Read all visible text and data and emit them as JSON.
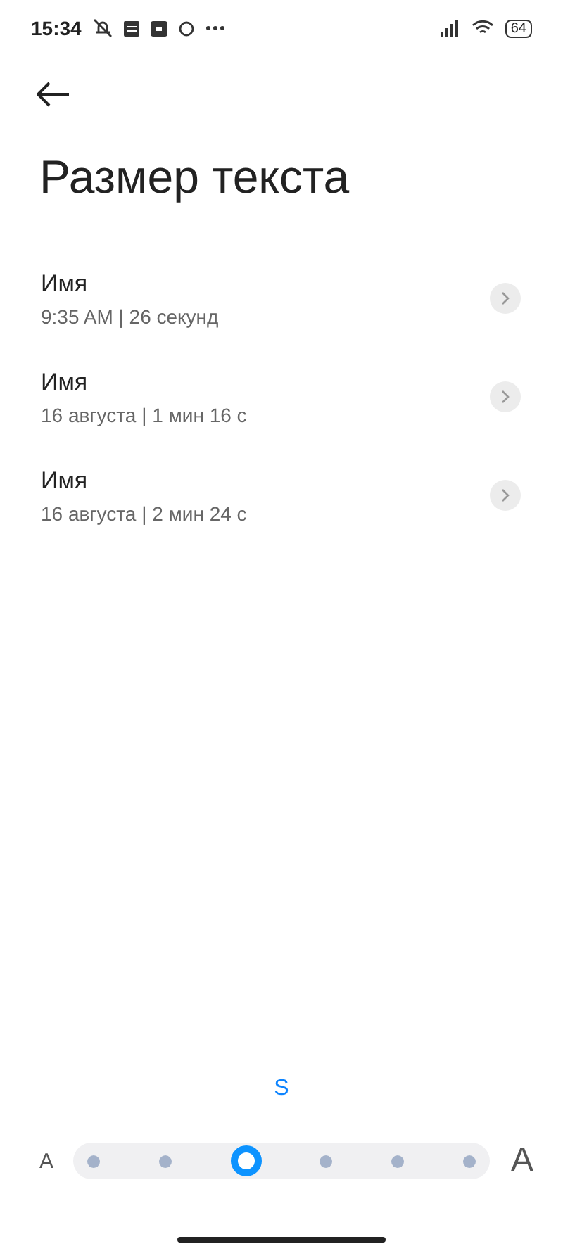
{
  "status_bar": {
    "time": "15:34",
    "battery": "64"
  },
  "title": "Размер текста",
  "items": [
    {
      "name": "Имя",
      "detail": "9:35 AM | 26 секунд"
    },
    {
      "name": "Имя",
      "detail": "16 августа | 1 мин 16 с"
    },
    {
      "name": "Имя",
      "detail": "16 августа | 2 мин 24 с"
    }
  ],
  "size_slider": {
    "current_label": "S",
    "small_label": "A",
    "large_label": "A",
    "stops": [
      {
        "selected": false
      },
      {
        "selected": false
      },
      {
        "selected": true
      },
      {
        "selected": false
      },
      {
        "selected": false
      },
      {
        "selected": false
      }
    ]
  }
}
